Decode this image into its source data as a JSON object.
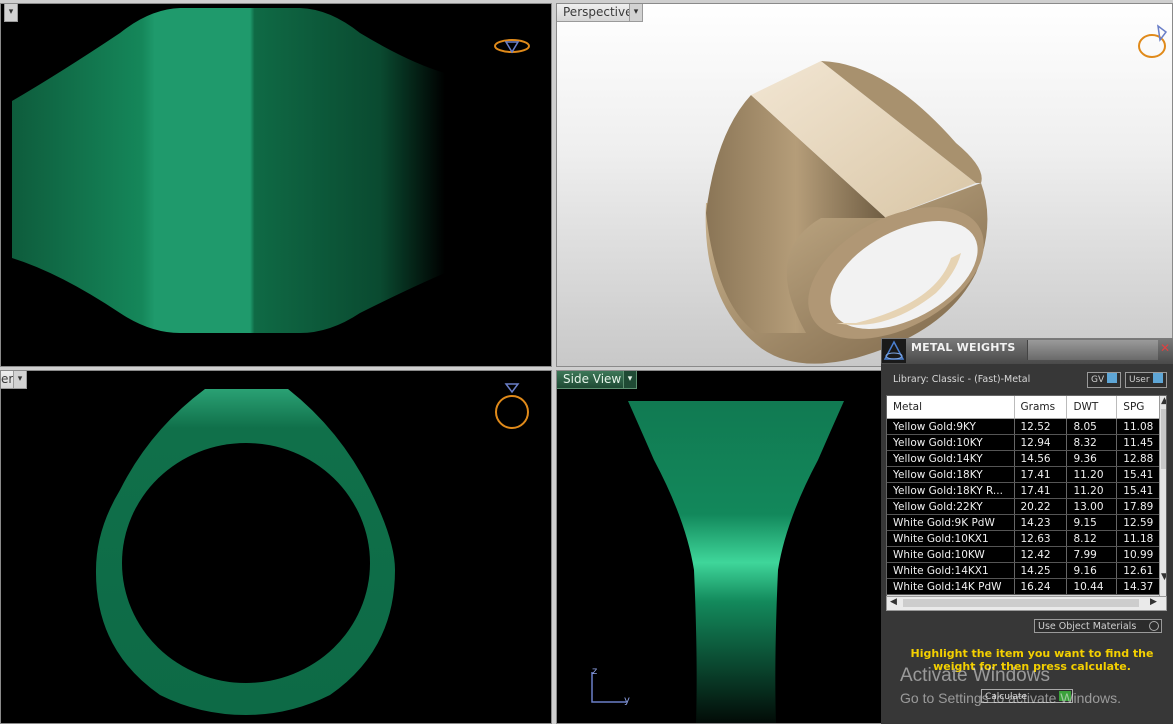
{
  "viewports": {
    "top_label": "",
    "perspective_label": "Perspective",
    "front_label": "er",
    "side_label": "Side View",
    "side_axes": {
      "z": "z",
      "y": "y"
    }
  },
  "metal_weights": {
    "title": "METAL WEIGHTS",
    "library": "Library: Classic - (Fast)-Metal",
    "toggle_gv": "GV",
    "toggle_user": "User",
    "columns": [
      "Metal",
      "Grams",
      "DWT",
      "SPG"
    ],
    "rows": [
      [
        "Yellow Gold:9KY",
        "12.52",
        "8.05",
        "11.08"
      ],
      [
        "Yellow Gold:10KY",
        "12.94",
        "8.32",
        "11.45"
      ],
      [
        "Yellow Gold:14KY",
        "14.56",
        "9.36",
        "12.88"
      ],
      [
        "Yellow Gold:18KY",
        "17.41",
        "11.20",
        "15.41"
      ],
      [
        "Yellow Gold:18KY R...",
        "17.41",
        "11.20",
        "15.41"
      ],
      [
        "Yellow Gold:22KY",
        "20.22",
        "13.00",
        "17.89"
      ],
      [
        "White Gold:9K PdW",
        "14.23",
        "9.15",
        "12.59"
      ],
      [
        "White Gold:10KX1",
        "12.63",
        "8.12",
        "11.18"
      ],
      [
        "White Gold:10KW",
        "12.42",
        "7.99",
        "10.99"
      ],
      [
        "White Gold:14KX1",
        "14.25",
        "9.16",
        "12.61"
      ],
      [
        "White Gold:14K PdW",
        "16.24",
        "10.44",
        "14.37"
      ]
    ],
    "use_object_materials": "Use Object Materials",
    "hint": "Highlight the item you want to find the weight for then press calculate.",
    "calculate_label": "Calculate"
  },
  "watermark": {
    "line1": "Activate Windows",
    "line2": "Go to Settings to activate Windows."
  },
  "colors": {
    "ring_green": "#1f8a5e",
    "ring_gold": "#c9b596",
    "hint_yellow": "#f4d000"
  }
}
